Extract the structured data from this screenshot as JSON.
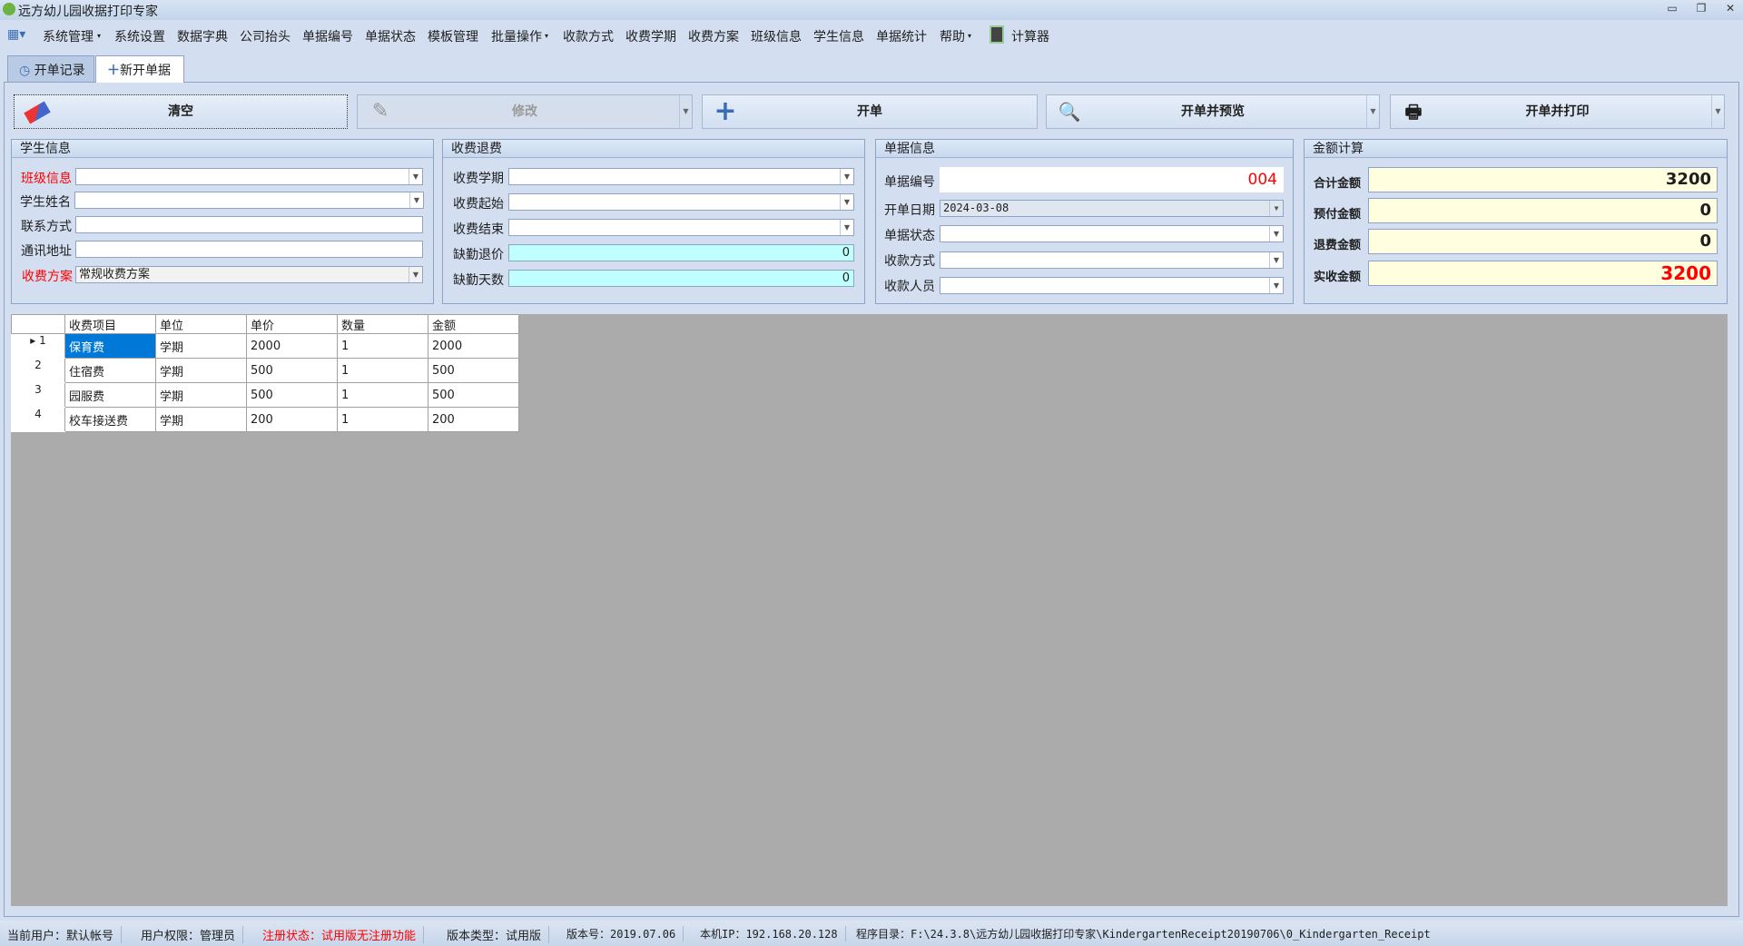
{
  "window": {
    "title": "远方幼儿园收据打印专家",
    "minimize": "▭",
    "restore": "❐",
    "close": "✕"
  },
  "menu": [
    "系统管理",
    "系统设置",
    "数据字典",
    "公司抬头",
    "单据编号",
    "单据状态",
    "模板管理",
    "批量操作",
    "收款方式",
    "收费学期",
    "收费方案",
    "班级信息",
    "学生信息",
    "单据统计",
    "帮助",
    "计算器"
  ],
  "tabs": [
    "开单记录",
    "新开单据"
  ],
  "toolbar": {
    "clear": "清空",
    "edit": "修改",
    "issue": "开单",
    "issue_preview": "开单并预览",
    "issue_print": "开单并打印"
  },
  "student": {
    "title": "学生信息",
    "class_label": "班级信息",
    "class_value": "",
    "name_label": "学生姓名",
    "name_value": "",
    "contact_label": "联系方式",
    "contact_value": "",
    "address_label": "通讯地址",
    "address_value": "",
    "plan_label": "收费方案",
    "plan_value": "常规收费方案"
  },
  "fee": {
    "title": "收费退费",
    "term_label": "收费学期",
    "start_label": "收费起始",
    "end_label": "收费结束",
    "absence_refund_label": "缺勤退价",
    "absence_refund_value": "0",
    "absence_days_label": "缺勤天数",
    "absence_days_value": "0"
  },
  "receipt": {
    "title": "单据信息",
    "no_label": "单据编号",
    "no_value": "004",
    "date_label": "开单日期",
    "date_value": "2024-03-08",
    "status_label": "单据状态",
    "method_label": "收款方式",
    "payee_label": "收款人员"
  },
  "amount": {
    "title": "金额计算",
    "total_label": "合计金额",
    "total_value": "3200",
    "prepaid_label": "预付金额",
    "prepaid_value": "0",
    "refund_label": "退费金额",
    "refund_value": "0",
    "actual_label": "实收金额",
    "actual_value": "3200"
  },
  "table": {
    "headers": [
      "收费项目",
      "单位",
      "单价",
      "数量",
      "金额"
    ],
    "rows": [
      [
        "1",
        "保育费",
        "学期",
        "2000",
        "1",
        "2000"
      ],
      [
        "2",
        "住宿费",
        "学期",
        "500",
        "1",
        "500"
      ],
      [
        "3",
        "园服费",
        "学期",
        "500",
        "1",
        "500"
      ],
      [
        "4",
        "校车接送费",
        "学期",
        "200",
        "1",
        "200"
      ]
    ]
  },
  "status": {
    "user": "当前用户：默认帐号",
    "role": "用户权限：管理员",
    "reg": "注册状态：试用版无注册功能",
    "type": "版本类型：试用版",
    "version": "版本号：2019.07.06",
    "ip": "本机IP：192.168.20.128",
    "path": "程序目录：F:\\24.3.8\\远方幼儿园收据打印专家\\KindergartenReceipt20190706\\0_Kindergarten_Receipt"
  }
}
